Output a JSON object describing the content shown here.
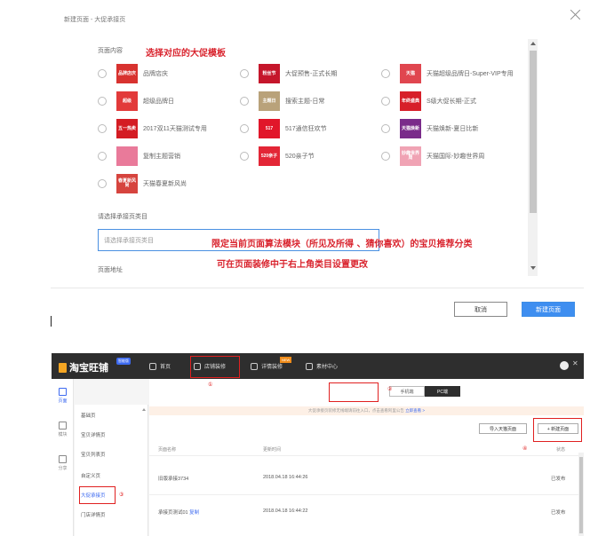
{
  "dialog": {
    "title": "新建页面 - 大促承接页",
    "section_content": "页面内容",
    "annotation_template": "选择对应的大促模板",
    "templates": [
      {
        "label": "品牌店庆",
        "thumb_text": "品牌店庆",
        "color": "#d8322f"
      },
      {
        "label": "大促预售-正式长期",
        "thumb_text": "粉丝节",
        "color": "#c5162b"
      },
      {
        "label": "天猫超级品牌日-Super-VIP专用",
        "thumb_text": "天猫",
        "color": "#e0464f"
      },
      {
        "label": "超级品牌日",
        "thumb_text": "超级",
        "color": "#e23a3a"
      },
      {
        "label": "搜索主题-日常",
        "thumb_text": "主题日",
        "color": "#b9a27a"
      },
      {
        "label": "S级大促长期-正式",
        "thumb_text": "年终盛典",
        "color": "#d71f29"
      },
      {
        "label": "2017双11天猫测试专用",
        "thumb_text": "五一热卖",
        "color": "#d41c23"
      },
      {
        "label": "517通信狂欢节",
        "thumb_text": "517",
        "color": "#e1162a"
      },
      {
        "label": "天猫焕新-夏日比新",
        "thumb_text": "天猫焕新",
        "color": "#7a2b8a"
      },
      {
        "label": "复制主题营销",
        "thumb_text": "",
        "color": "#e97a9a"
      },
      {
        "label": "520亲子节",
        "thumb_text": "520亲子",
        "color": "#e32636"
      },
      {
        "label": "天猫国际-妙趣世界周",
        "thumb_text": "妙趣世界周",
        "color": "#f0a3b4"
      },
      {
        "label": "天猫春夏新风尚",
        "thumb_text": "春夏新风尚",
        "color": "#d6443e"
      }
    ],
    "category_label": "请选择承接页类目",
    "category_placeholder": "请选择承接页类目",
    "annotation_category_1": "限定当前页面算法模块（所见及所得 、猜你喜欢）的宝贝推荐分类",
    "annotation_category_2": "可在页面装修中于右上角类目设置更改",
    "section_address": "页面地址",
    "cancel_label": "取消",
    "create_label": "新建页面"
  },
  "app": {
    "logo": "淘宝旺铺",
    "logo_badge": "智能版",
    "tabs": [
      {
        "label": "首页"
      },
      {
        "label": "店铺装修"
      },
      {
        "label": "详情装修"
      },
      {
        "label": "素材中心"
      }
    ],
    "new_badge": "NEW",
    "rail": [
      {
        "label": "页面"
      },
      {
        "label": "模块"
      },
      {
        "label": "分享"
      }
    ],
    "side_items": [
      "基础页",
      "宝贝详情页",
      "宝贝列表页",
      "自定义页",
      "大促承接页",
      "门店详情页"
    ],
    "toggle": {
      "mobile": "手机端",
      "pc": "PC端"
    },
    "notice": "大促承接页装修无线端请前往入口，点击查看阿里公告",
    "notice_link": "立即查看 >",
    "import_button": "导入天猫页面",
    "new_page_button": "+ 新建页面",
    "columns": {
      "name": "页面名称",
      "time": "更新时间",
      "status": "状态"
    },
    "rows": [
      {
        "name": "旧版承接3734",
        "extra": "",
        "time": "2018.04.18 16:44:26",
        "status": "已发布"
      },
      {
        "name": "承接页测试01",
        "extra": "复制",
        "time": "2018.04.18 16:44:22",
        "status": "已发布"
      }
    ],
    "markers": [
      "①",
      "②",
      "③",
      "④"
    ]
  }
}
